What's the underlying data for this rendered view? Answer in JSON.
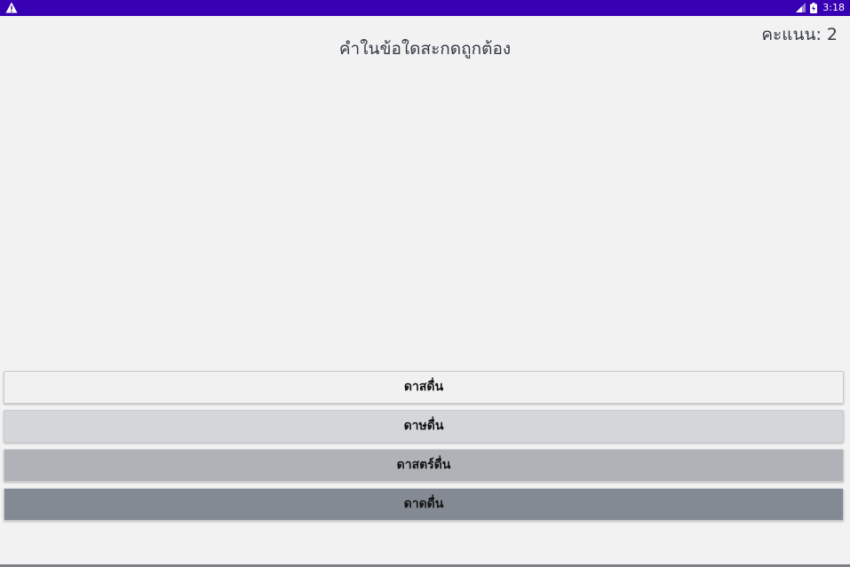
{
  "status_bar": {
    "left_icon": "warning-icon",
    "right_icons": [
      "signal-icon",
      "battery-icon"
    ],
    "time": "3:18",
    "background": "#3700b3"
  },
  "score": {
    "text": "คะแนน: 2"
  },
  "question": {
    "text": "คำในข้อใดสะกดถูกต้อง"
  },
  "answers": [
    {
      "label": "ดาสดื่น",
      "color": "#f1f1f1"
    },
    {
      "label": "ดาษดื่น",
      "color": "#d4d7da"
    },
    {
      "label": "ดาสตร์ดื่น",
      "color": "#afb3b8"
    },
    {
      "label": "ดาดดื่น",
      "color": "#838a93"
    }
  ]
}
